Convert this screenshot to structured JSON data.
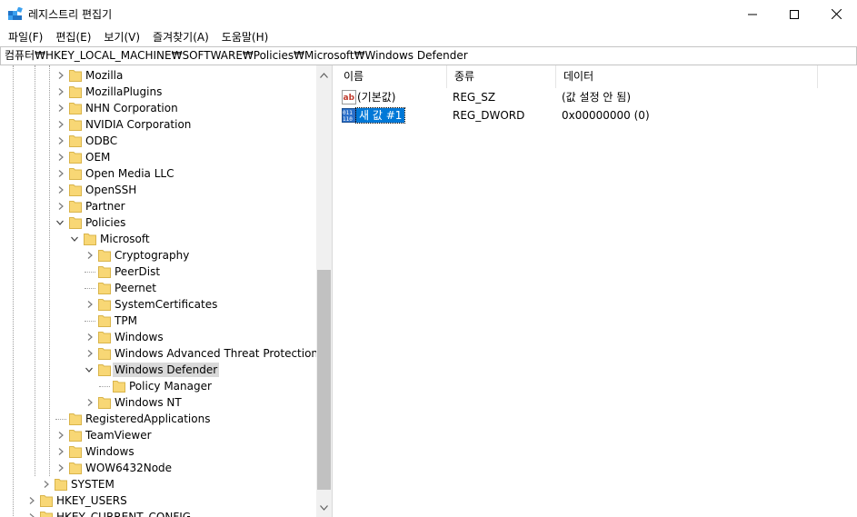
{
  "window": {
    "title": "레지스트리 편집기"
  },
  "menu": [
    "파일(F)",
    "편집(E)",
    "보기(V)",
    "즐겨찾기(A)",
    "도움말(H)"
  ],
  "address": "컴퓨터₩HKEY_LOCAL_MACHINE₩SOFTWARE₩Policies₩Microsoft₩Windows Defender",
  "tree": {
    "items": [
      {
        "label": "Mozilla",
        "depth": 2,
        "expander": "collapsed"
      },
      {
        "label": "MozillaPlugins",
        "depth": 2,
        "expander": "collapsed"
      },
      {
        "label": "NHN Corporation",
        "depth": 2,
        "expander": "collapsed"
      },
      {
        "label": "NVIDIA Corporation",
        "depth": 2,
        "expander": "collapsed"
      },
      {
        "label": "ODBC",
        "depth": 2,
        "expander": "collapsed"
      },
      {
        "label": "OEM",
        "depth": 2,
        "expander": "collapsed"
      },
      {
        "label": "Open Media LLC",
        "depth": 2,
        "expander": "collapsed"
      },
      {
        "label": "OpenSSH",
        "depth": 2,
        "expander": "collapsed"
      },
      {
        "label": "Partner",
        "depth": 2,
        "expander": "collapsed"
      },
      {
        "label": "Policies",
        "depth": 2,
        "expander": "expanded"
      },
      {
        "label": "Microsoft",
        "depth": 3,
        "expander": "expanded"
      },
      {
        "label": "Cryptography",
        "depth": 4,
        "expander": "collapsed"
      },
      {
        "label": "PeerDist",
        "depth": 4,
        "expander": "none"
      },
      {
        "label": "Peernet",
        "depth": 4,
        "expander": "none"
      },
      {
        "label": "SystemCertificates",
        "depth": 4,
        "expander": "collapsed"
      },
      {
        "label": "TPM",
        "depth": 4,
        "expander": "none"
      },
      {
        "label": "Windows",
        "depth": 4,
        "expander": "collapsed"
      },
      {
        "label": "Windows Advanced Threat Protection",
        "depth": 4,
        "expander": "collapsed"
      },
      {
        "label": "Windows Defender",
        "depth": 4,
        "expander": "expanded",
        "selected": true
      },
      {
        "label": "Policy Manager",
        "depth": 5,
        "expander": "none"
      },
      {
        "label": "Windows NT",
        "depth": 4,
        "expander": "collapsed"
      },
      {
        "label": "RegisteredApplications",
        "depth": 2,
        "expander": "none"
      },
      {
        "label": "TeamViewer",
        "depth": 2,
        "expander": "collapsed"
      },
      {
        "label": "Windows",
        "depth": 2,
        "expander": "collapsed"
      },
      {
        "label": "WOW6432Node",
        "depth": 2,
        "expander": "collapsed"
      },
      {
        "label": "SYSTEM",
        "depth": 1,
        "expander": "collapsed"
      },
      {
        "label": "HKEY_USERS",
        "depth": 0,
        "expander": "collapsed"
      },
      {
        "label": "HKEY_CURRENT_CONFIG",
        "depth": 0,
        "expander": "collapsed"
      }
    ]
  },
  "list": {
    "columns": [
      "이름",
      "종류",
      "데이터"
    ],
    "rows": [
      {
        "icon": "string-value-icon",
        "name": "(기본값)",
        "type": "REG_SZ",
        "data": "(값 설정 안 됨)",
        "selected": false
      },
      {
        "icon": "binary-value-icon",
        "name": "새 값 #1",
        "type": "REG_DWORD",
        "data": "0x00000000 (0)",
        "selected": true
      }
    ]
  },
  "colors": {
    "folder": "#f8d775",
    "folder_edge": "#d9b44a",
    "selection": "#0078d7",
    "tree_selected": "#d9d9d9"
  }
}
